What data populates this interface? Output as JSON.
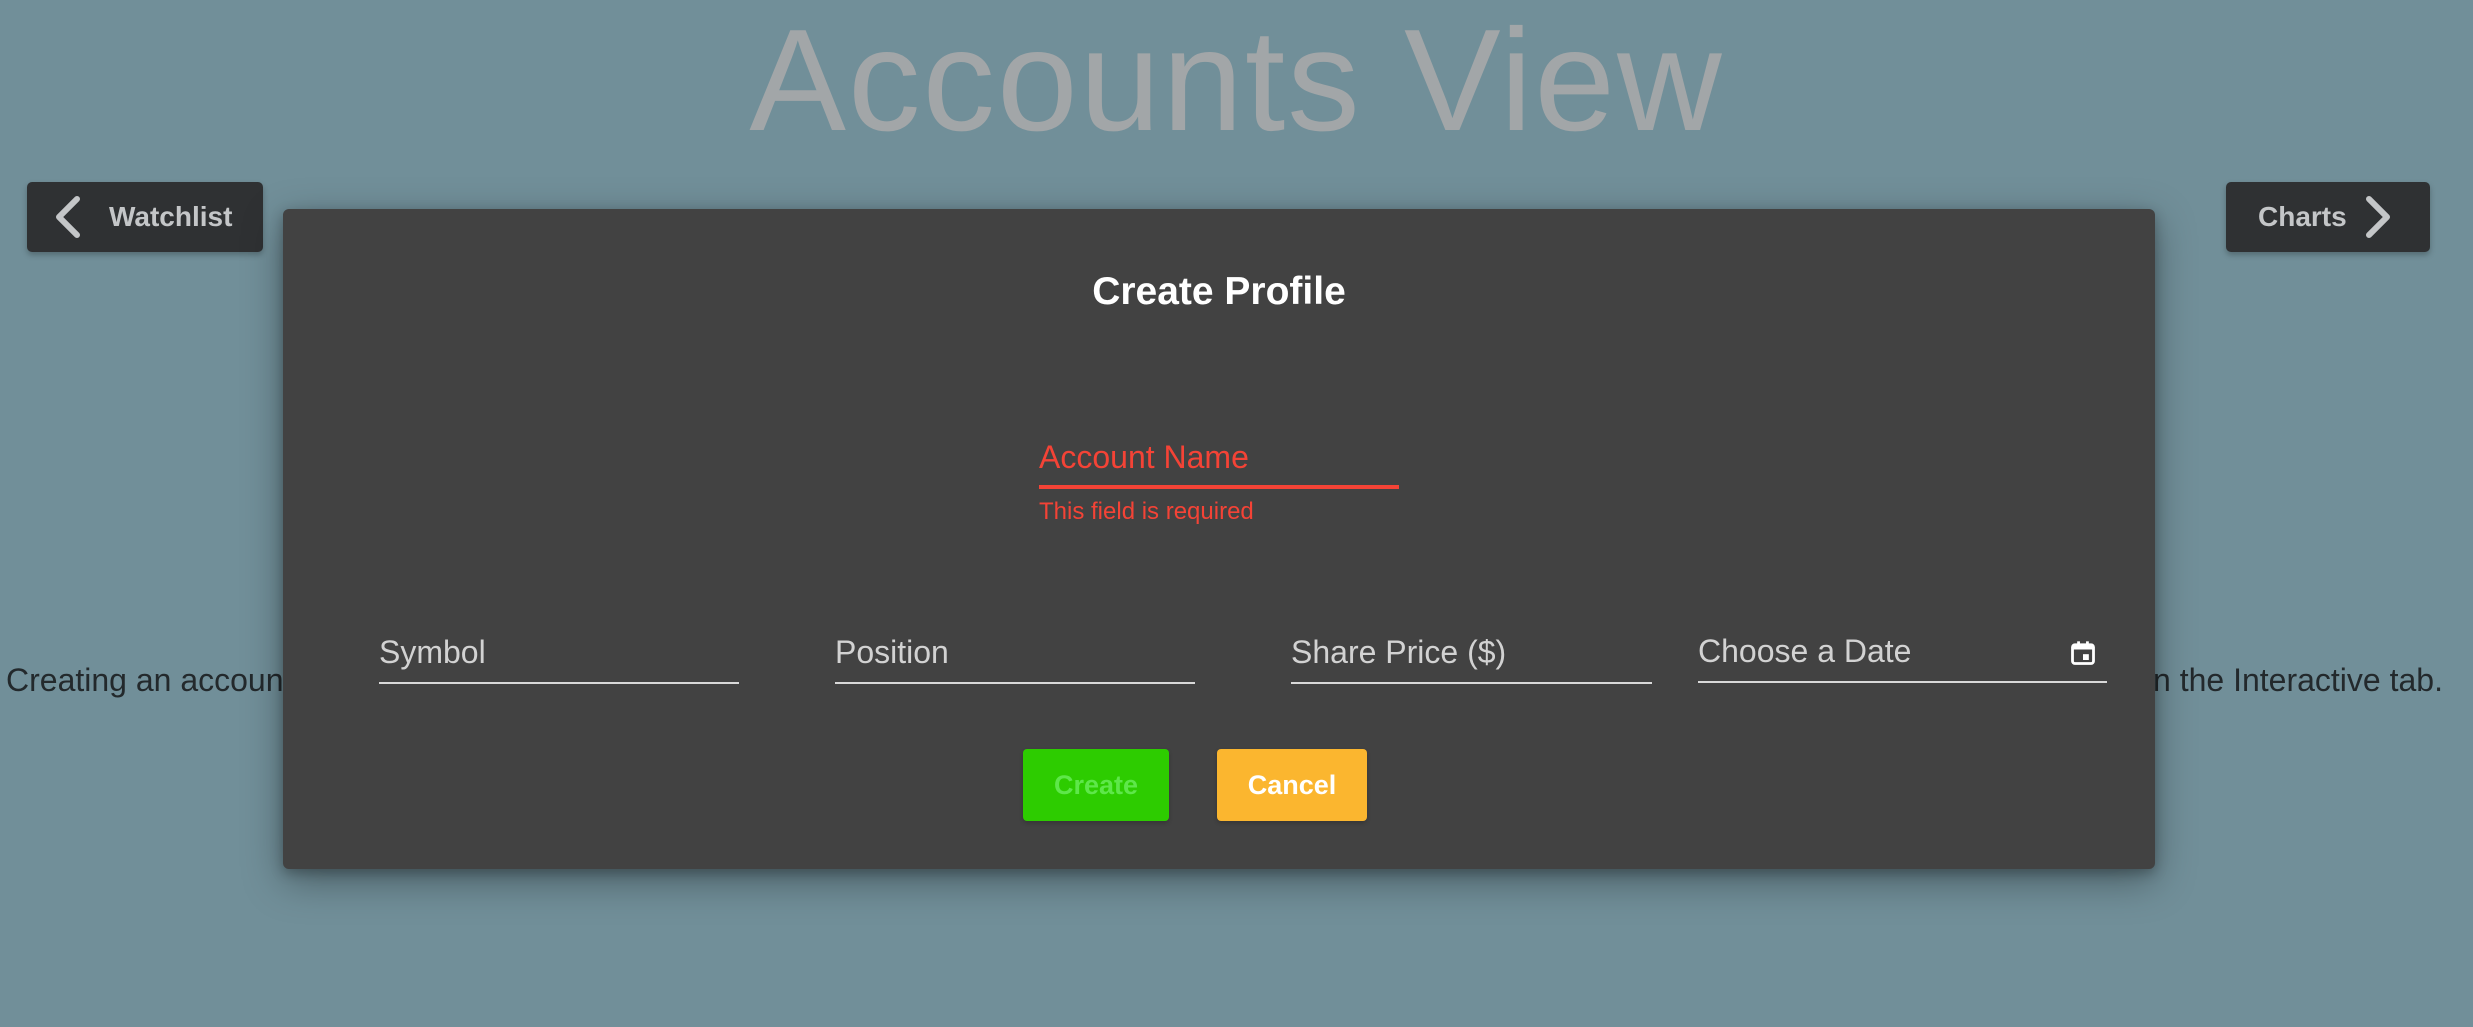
{
  "page": {
    "title": "Accounts View",
    "nav_left_label": "Watchlist",
    "nav_right_label": "Charts",
    "background_text_left": "Creating an account",
    "background_text_right": "n the Interactive tab."
  },
  "dialog": {
    "title": "Create Profile",
    "account_name": {
      "label": "Account Name",
      "value": "",
      "error": "This field is required"
    },
    "fields": {
      "symbol": "Symbol",
      "position": "Position",
      "share_price": "Share Price ($)",
      "date": "Choose a Date"
    },
    "buttons": {
      "create": "Create",
      "cancel": "Cancel"
    }
  },
  "icons": {
    "nav_left": "chevron-left-icon",
    "nav_right": "chevron-right-icon",
    "date": "calendar-icon"
  },
  "colors": {
    "background": "#718f99",
    "dialog": "#424242",
    "error": "#f44336",
    "create_button": "#2dcc00",
    "cancel_button": "#fbb62f",
    "nav_button": "#2f3133"
  }
}
